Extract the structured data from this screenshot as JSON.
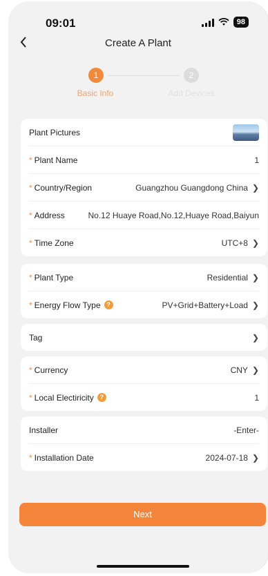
{
  "status": {
    "time": "09:01",
    "battery": "98"
  },
  "nav": {
    "title": "Create A Plant"
  },
  "steps": [
    {
      "number": "1",
      "label": "Basic Info"
    },
    {
      "number": "2",
      "label": "Add Devices"
    }
  ],
  "basic": {
    "plant_pictures": "Plant Pictures",
    "plant_name": {
      "label": "Plant Name",
      "value": "1"
    },
    "country": {
      "label": "Country/Region",
      "value": "Guangzhou Guangdong China"
    },
    "address": {
      "label": "Address",
      "value": "No.12 Huaye Road,No.12,Huaye Road,Baiyun"
    },
    "timezone": {
      "label": "Time Zone",
      "value": "UTC+8"
    }
  },
  "type": {
    "plant_type": {
      "label": "Plant Type",
      "value": "Residential"
    },
    "energy_flow": {
      "label": "Energy Flow Type",
      "value": "PV+Grid+Battery+Load"
    }
  },
  "tag": {
    "label": "Tag"
  },
  "finance": {
    "currency": {
      "label": "Currency",
      "value": "CNY"
    },
    "electricity": {
      "label": "Local Electiricity",
      "value": "1"
    }
  },
  "install": {
    "installer": {
      "label": "Installer",
      "placeholder": "-Enter-"
    },
    "date": {
      "label": "Installation Date",
      "value": "2024-07-18"
    }
  },
  "next_label": "Next",
  "icons": {
    "back": "chevron-left-icon",
    "chevron": "chevron-right-icon",
    "help": "question-icon"
  },
  "colors": {
    "accent": "#f5853a",
    "inactive": "#dcdcdc"
  }
}
